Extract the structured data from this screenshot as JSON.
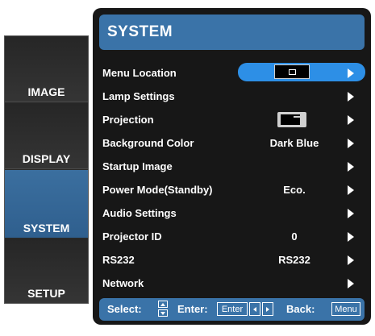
{
  "tabs": [
    {
      "label": "IMAGE"
    },
    {
      "label": "DISPLAY"
    },
    {
      "label": "SYSTEM"
    },
    {
      "label": "SETUP"
    }
  ],
  "active_tab": "SYSTEM",
  "title": "SYSTEM",
  "menu": [
    {
      "label": "Menu Location",
      "value": "",
      "selected": true
    },
    {
      "label": "Lamp Settings",
      "value": ""
    },
    {
      "label": "Projection",
      "value": ""
    },
    {
      "label": "Background Color",
      "value": "Dark Blue"
    },
    {
      "label": "Startup Image",
      "value": ""
    },
    {
      "label": "Power Mode(Standby)",
      "value": "Eco."
    },
    {
      "label": "Audio Settings",
      "value": ""
    },
    {
      "label": "Projector ID",
      "value": "0"
    },
    {
      "label": "RS232",
      "value": "RS232"
    },
    {
      "label": "Network",
      "value": ""
    }
  ],
  "help": {
    "select_label": "Select:",
    "enter_label": "Enter:",
    "enter_key": "Enter",
    "back_label": "Back:",
    "menu_key": "Menu"
  },
  "colors": {
    "accent": "#3a73a8",
    "selection": "#2d8fe6",
    "panel": "#171717"
  }
}
